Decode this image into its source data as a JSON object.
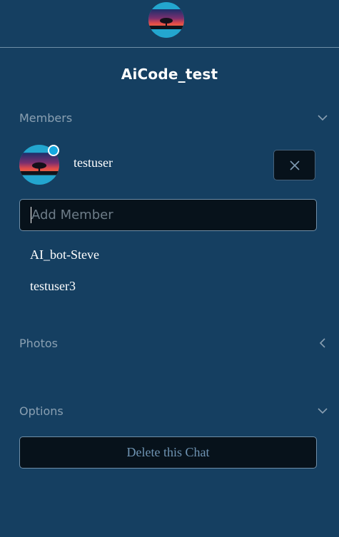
{
  "header": {
    "chat_avatar_icon": "tree-sunset-avatar",
    "title": "AiCode_test"
  },
  "members": {
    "label": "Members",
    "toggle_icon": "chevron-down-icon",
    "list": [
      {
        "name": "testuser",
        "avatar_icon": "tree-sunset-avatar",
        "online": true
      }
    ],
    "remove_icon": "close-icon",
    "add_placeholder": "Add Member",
    "add_value": "",
    "suggestions": [
      "AI_bot-Steve",
      "testuser3"
    ]
  },
  "photos": {
    "label": "Photos",
    "toggle_icon": "chevron-left-icon"
  },
  "options": {
    "label": "Options",
    "toggle_icon": "chevron-down-icon",
    "delete_label": "Delete this Chat"
  },
  "colors": {
    "background": "#153f61",
    "input_background": "#07121b",
    "status_online": "#14a8e0",
    "muted_text": "#8aa0b2"
  }
}
